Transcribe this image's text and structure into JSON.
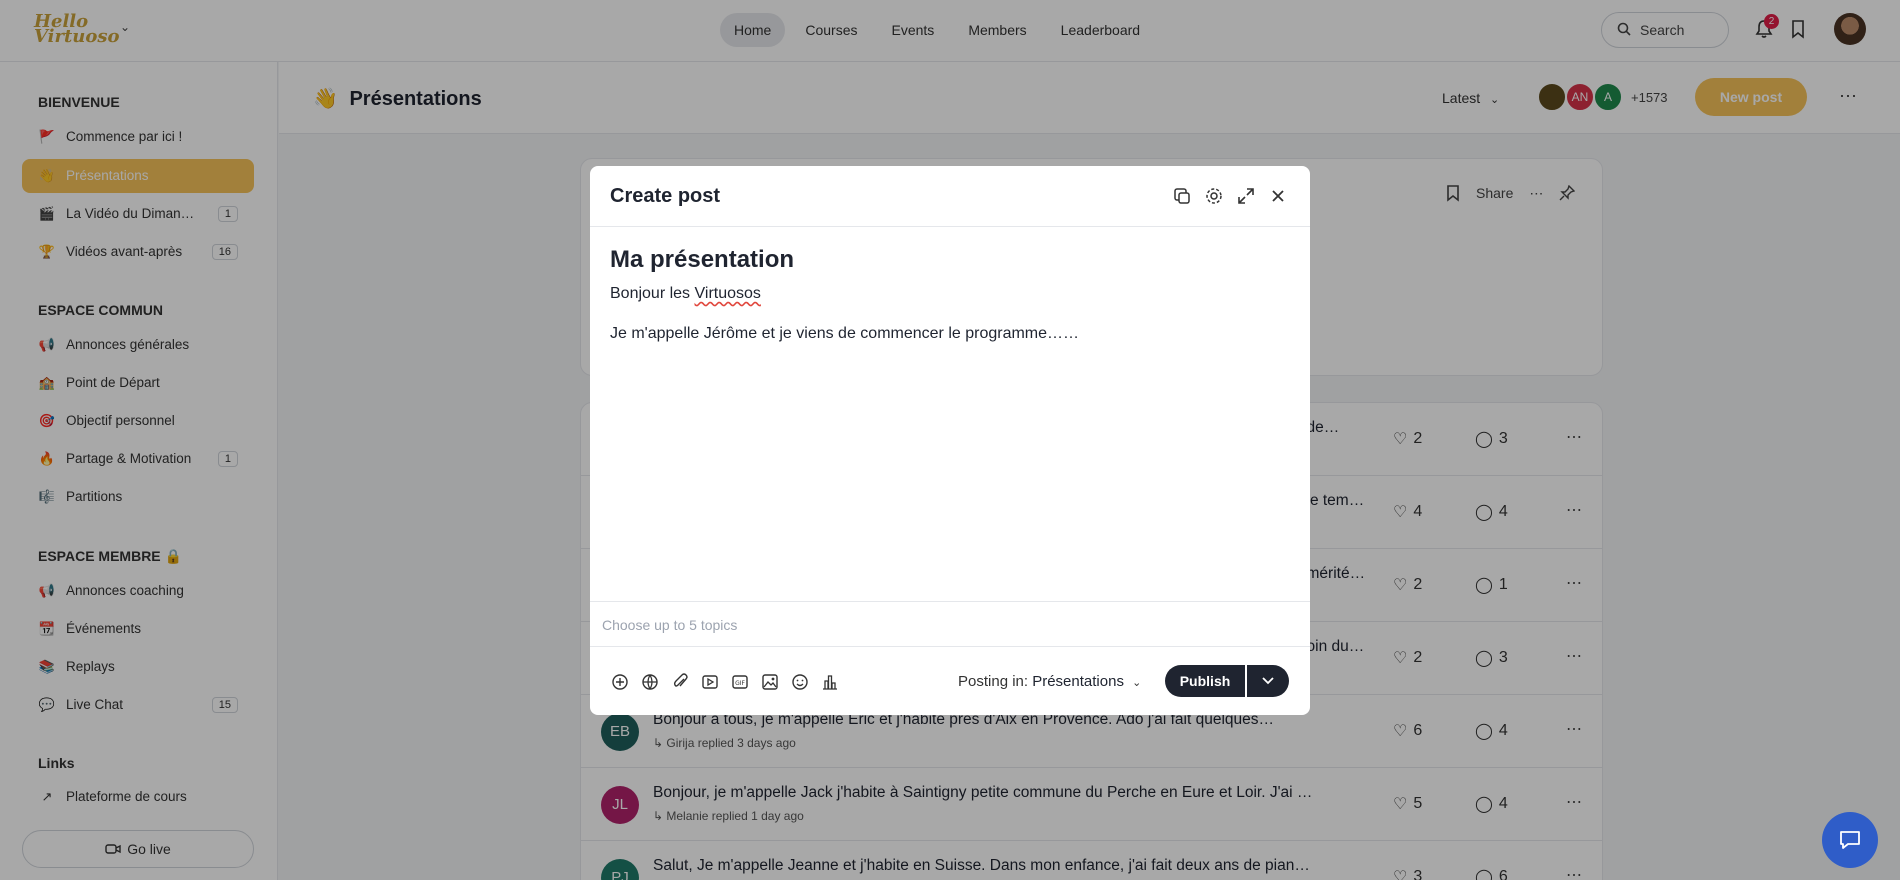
{
  "topbar": {
    "logo_text_1": "Hello",
    "logo_text_2": "Virtuoso",
    "nav": [
      "Home",
      "Courses",
      "Events",
      "Members",
      "Leaderboard"
    ],
    "search_label": "Search",
    "notification_count": "2"
  },
  "sidebar": {
    "sections": [
      {
        "title": "BIENVENUE"
      },
      {
        "title": "ESPACE COMMUN"
      },
      {
        "title": "ESPACE MEMBRE 🔒"
      },
      {
        "title": "Links"
      }
    ],
    "items": [
      {
        "emoji": "🚩",
        "label": "Commence par ici !"
      },
      {
        "emoji": "👋",
        "label": "Présentations"
      },
      {
        "emoji": "🎬",
        "label": "La Vidéo du Dimanche",
        "count": "1"
      },
      {
        "emoji": "🏆",
        "label": "Vidéos avant-après",
        "count": "16"
      },
      {
        "emoji": "📢",
        "label": "Annonces générales"
      },
      {
        "emoji": "🏫",
        "label": "Point de Départ"
      },
      {
        "emoji": "🎯",
        "label": "Objectif personnel"
      },
      {
        "emoji": "🔥",
        "label": "Partage & Motivation",
        "count": "1"
      },
      {
        "emoji": "🎼",
        "label": "Partitions"
      },
      {
        "emoji": "📢",
        "label": "Annonces coaching"
      },
      {
        "emoji": "📆",
        "label": "Événements"
      },
      {
        "emoji": "📚",
        "label": "Replays"
      },
      {
        "emoji": "💬",
        "label": "Live Chat",
        "count": "15"
      },
      {
        "emoji": "↗",
        "label": "Plateforme de cours"
      }
    ],
    "go_live": "Go live"
  },
  "main": {
    "title_emoji": "👋",
    "title": "Présentations",
    "sort_label": "Latest",
    "avatars": [
      {
        "initials": "",
        "color": "#5b4a1e"
      },
      {
        "initials": "AN",
        "color": "#d6334a"
      },
      {
        "initials": "A",
        "color": "#1f8a4c"
      }
    ],
    "member_count": "+1573",
    "new_post": "New post",
    "share_label": "Share"
  },
  "posts": [
    {
      "initials": "",
      "color": "#6b7280",
      "text": "…de…",
      "meta": "",
      "likes": "2",
      "comments": "3"
    },
    {
      "initials": "",
      "color": "#6b7280",
      "text": "…le tem…",
      "meta": "",
      "likes": "4",
      "comments": "4"
    },
    {
      "initials": "",
      "color": "#6b7280",
      "text": "…mérité…",
      "meta": "",
      "likes": "2",
      "comments": "1"
    },
    {
      "initials": "",
      "color": "#6b7280",
      "text": "…oin du…",
      "meta": "",
      "likes": "2",
      "comments": "3"
    },
    {
      "initials": "EB",
      "color": "#1f5f5b",
      "text": "Bonjour à tous, je m'appelle Eric et j'habite près d'Aix en Provence. Ado j'ai fait quelques…",
      "meta": "↳ Girija replied 3 days ago",
      "likes": "6",
      "comments": "4"
    },
    {
      "initials": "JL",
      "color": "#b0226b",
      "text": "Bonjour, je m'appelle Jack j'habite à Saintigny petite commune du Perche en Eure et Loir. J'ai …",
      "meta": "↳ Melanie replied 1 day ago",
      "likes": "5",
      "comments": "4"
    },
    {
      "initials": "PJ",
      "color": "#1f7a6a",
      "text": "Salut, Je m'appelle Jeanne et j'habite en Suisse. Dans mon enfance, j'ai fait deux ans de pian…",
      "meta": "",
      "likes": "3",
      "comments": "6"
    }
  ],
  "modal": {
    "title": "Create post",
    "post_title": "Ma présentation",
    "line1_prefix": "Bonjour les ",
    "line1_word": "Virtuosos",
    "line2": "Je m'appelle Jérôme et je viens de commencer le programme……",
    "topics_placeholder": "Choose up to 5 topics",
    "posting_in_label": "Posting in:",
    "posting_in_value": "Présentations",
    "publish": "Publish"
  },
  "colors": {
    "accent": "#f6c35a",
    "dark": "#1f2430",
    "chat": "#2f5dc8"
  }
}
